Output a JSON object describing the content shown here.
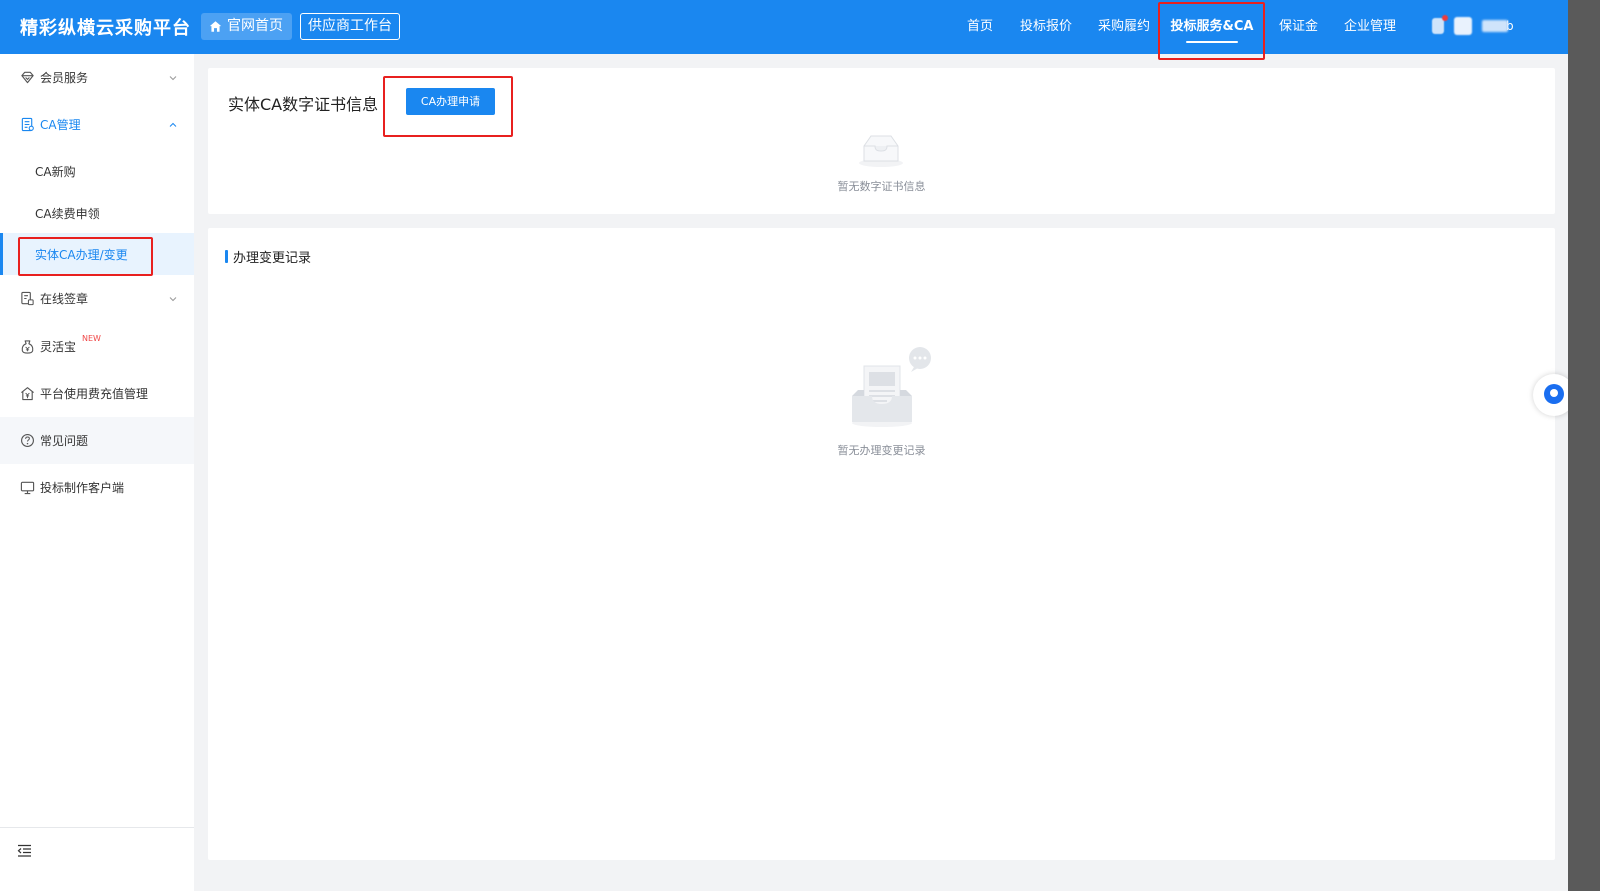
{
  "header": {
    "brand": "精彩纵横云采购平台",
    "home_label": "官网首页",
    "workspace_label": "供应商工作台",
    "nav": [
      "首页",
      "投标报价",
      "采购履约",
      "投标服务&CA",
      "保证金",
      "企业管理"
    ],
    "active_nav": "投标服务&CA",
    "user_name_tail": "b"
  },
  "sidebar": {
    "items": [
      {
        "label": "会员服务",
        "icon": "diamond-icon"
      },
      {
        "label": "CA管理",
        "icon": "certificate-icon"
      },
      {
        "label": "CA新购"
      },
      {
        "label": "CA续费申领"
      },
      {
        "label": "实体CA办理/变更"
      },
      {
        "label": "在线签章",
        "icon": "seal-icon"
      },
      {
        "label": "灵活宝",
        "icon": "money-bag-icon",
        "badge": "NEW"
      },
      {
        "label": "平台使用费充值管理",
        "icon": "house-yuan-icon"
      },
      {
        "label": "常见问题",
        "icon": "question-icon"
      },
      {
        "label": "投标制作客户端",
        "icon": "monitor-icon"
      }
    ],
    "selected": "实体CA办理/变更"
  },
  "main": {
    "cert_title": "实体CA数字证书信息",
    "apply_button": "CA办理申请",
    "cert_empty": "暂无数字证书信息",
    "records_title": "办理变更记录",
    "records_empty": "暂无办理变更记录"
  },
  "colors": {
    "primary": "#1a87f0",
    "highlight_box": "#e8201f",
    "new_badge": "#f04848"
  }
}
